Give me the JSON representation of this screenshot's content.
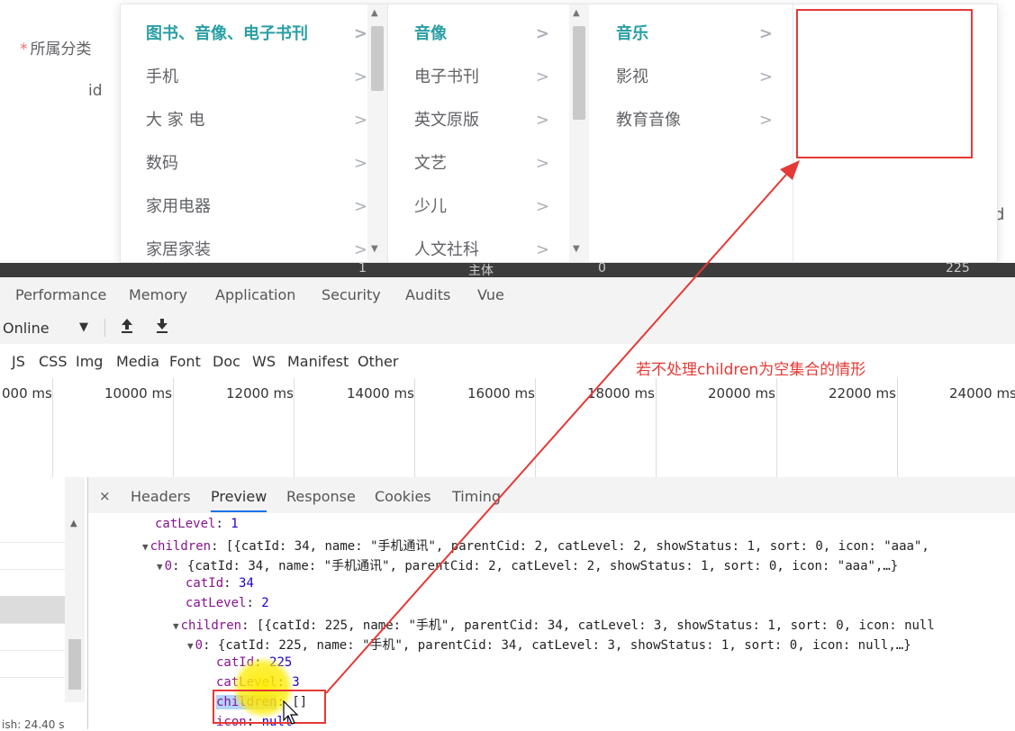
{
  "form": {
    "category_label": "所属分类",
    "required_mark": "*",
    "id_label": "id"
  },
  "cascader": {
    "col1": [
      "图书、音像、电子书刊",
      "手机",
      "大 家 电",
      "数码",
      "家用电器",
      "家居家装"
    ],
    "col2": [
      "音像",
      "电子书刊",
      "英文原版",
      "文艺",
      "少儿",
      "人文社科"
    ],
    "col3": [
      "音乐",
      "影视",
      "教育音像"
    ],
    "arrow": ">"
  },
  "background_fragments": {
    "right_d": "d",
    "bottom_row": [
      "1",
      "主体",
      "0",
      "225"
    ]
  },
  "devtools": {
    "tabs": [
      "Performance",
      "Memory",
      "Application",
      "Security",
      "Audits",
      "Vue"
    ],
    "throttle": "Online",
    "throttle_caret": "▼",
    "filters": [
      "JS",
      "CSS",
      "Img",
      "Media",
      "Font",
      "Doc",
      "WS",
      "Manifest",
      "Other"
    ],
    "timeline_ticks": [
      "000 ms",
      "10000 ms",
      "12000 ms",
      "14000 ms",
      "16000 ms",
      "18000 ms",
      "20000 ms",
      "22000 ms",
      "24000 ms"
    ],
    "detail_close": "×",
    "detail_tabs": [
      "Headers",
      "Preview",
      "Response",
      "Cookies",
      "Timing"
    ],
    "active_detail_tab": "Preview",
    "left_footer": "ish: 24.40 s"
  },
  "preview": {
    "lines": [
      {
        "k": "catLevel",
        "v": "1"
      },
      {
        "k": "children",
        "v": "[{catId: 34, name: \"手机通讯\", parentCid: 2, catLevel: 2, showStatus: 1, sort: 0, icon: \"aaa\","
      },
      {
        "k": "0",
        "v": "{catId: 34, name: \"手机通讯\", parentCid: 2, catLevel: 2, showStatus: 1, sort: 0, icon: \"aaa\",…}"
      },
      {
        "k": "catId",
        "v": "34"
      },
      {
        "k": "catLevel",
        "v": "2"
      },
      {
        "k": "children",
        "v": "[{catId: 225, name: \"手机\", parentCid: 34, catLevel: 3, showStatus: 1, sort: 0, icon: null"
      },
      {
        "k": "0",
        "v": "{catId: 225, name: \"手机\", parentCid: 34, catLevel: 3, showStatus: 1, sort: 0, icon: null,…}"
      },
      {
        "k": "catId",
        "v": "225"
      },
      {
        "k": "catLevel",
        "v": "3"
      },
      {
        "k": "children",
        "v": "[]"
      },
      {
        "k": "icon",
        "v": "null"
      }
    ]
  },
  "annotation": {
    "text": "若不处理children为空集合的情形",
    "color": "#e53935"
  },
  "colors": {
    "active_item": "#2a9fa5",
    "annotation_red": "#e53935",
    "tab_underline": "#1a73e8"
  }
}
